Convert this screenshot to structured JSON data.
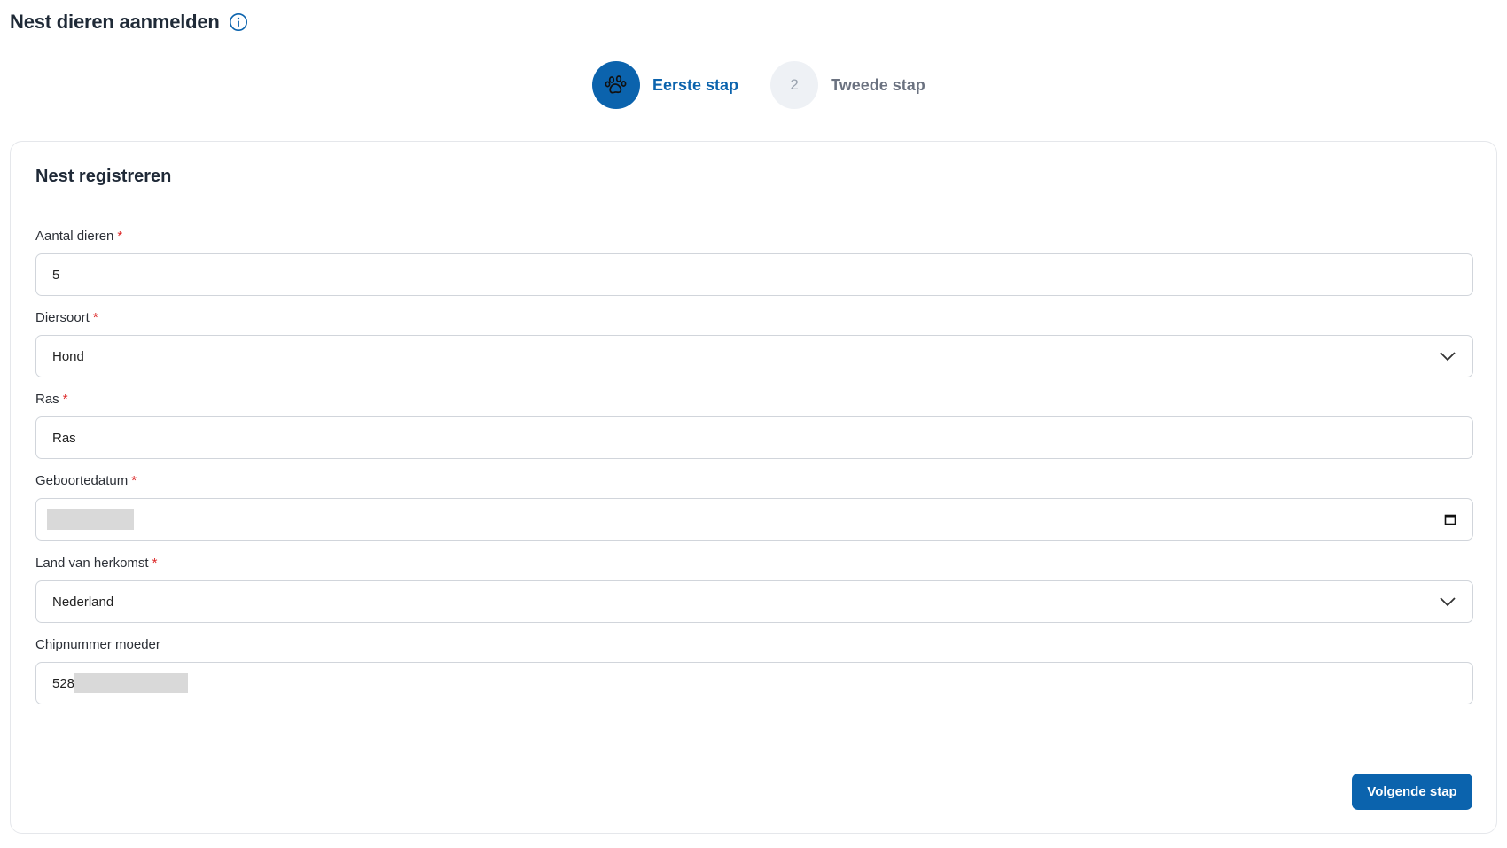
{
  "header": {
    "title": "Nest dieren aanmelden",
    "info_icon": "info-circle-icon"
  },
  "stepper": {
    "steps": [
      {
        "icon": "paw-icon",
        "label": "Eerste stap",
        "state": "active"
      },
      {
        "number": "2",
        "label": "Tweede stap",
        "state": "inactive"
      }
    ]
  },
  "form": {
    "title": "Nest registreren",
    "required_marker": "*",
    "fields": {
      "aantal": {
        "label": "Aantal dieren",
        "value": "5"
      },
      "diersoort": {
        "label": "Diersoort",
        "value": "Hond"
      },
      "ras": {
        "label": "Ras",
        "value": "Ras"
      },
      "geboortedatum": {
        "label": "Geboortedatum",
        "value": ""
      },
      "land": {
        "label": "Land van herkomst",
        "value": "Nederland"
      },
      "chip": {
        "label": "Chipnummer moeder",
        "value": "528"
      }
    },
    "submit_label": "Volgende stap"
  },
  "colors": {
    "primary": "#0b63ad",
    "required": "#dc2626",
    "border": "#d1d5db"
  }
}
